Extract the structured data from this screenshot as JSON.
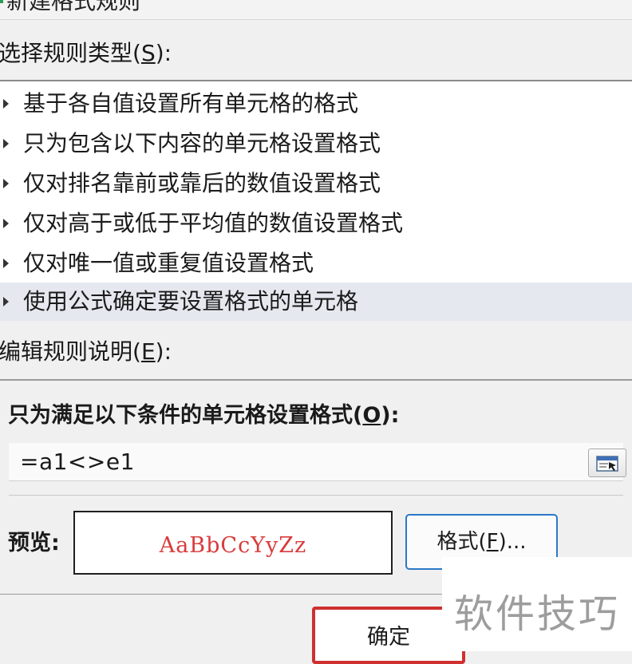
{
  "dialog": {
    "title": "新建格式规则"
  },
  "rule_type_section": {
    "label": "选择规则类型(",
    "hotkey": "S",
    "suffix": "):"
  },
  "rule_types": [
    {
      "label": "基于各自值设置所有单元格的格式",
      "selected": false
    },
    {
      "label": "只为包含以下内容的单元格设置格式",
      "selected": false
    },
    {
      "label": "仅对排名靠前或靠后的数值设置格式",
      "selected": false
    },
    {
      "label": "仅对高于或低于平均值的数值设置格式",
      "selected": false
    },
    {
      "label": "仅对唯一值或重复值设置格式",
      "selected": false
    },
    {
      "label": "使用公式确定要设置格式的单元格",
      "selected": true
    }
  ],
  "edit_section": {
    "label": "编辑规则说明(",
    "hotkey": "E",
    "suffix": "):"
  },
  "condition": {
    "label": "只为满足以下条件的单元格设置格式(",
    "hotkey": "O",
    "suffix": "):",
    "formula_value": "=a1<>e1",
    "collapse_icon": "collapse-dialog-icon"
  },
  "preview": {
    "label": "预览:",
    "sample_text": "AaBbCcYyZz",
    "sample_color": "#d83b3b"
  },
  "buttons": {
    "format_label": "格式(",
    "format_hotkey": "F",
    "format_suffix": ")...",
    "ok_label": "确定"
  },
  "watermark": {
    "text": "软件技巧"
  },
  "colors": {
    "selected_row": "#e5e9ef",
    "focus_border": "#2b78c6",
    "ok_highlight": "#cf3030"
  }
}
